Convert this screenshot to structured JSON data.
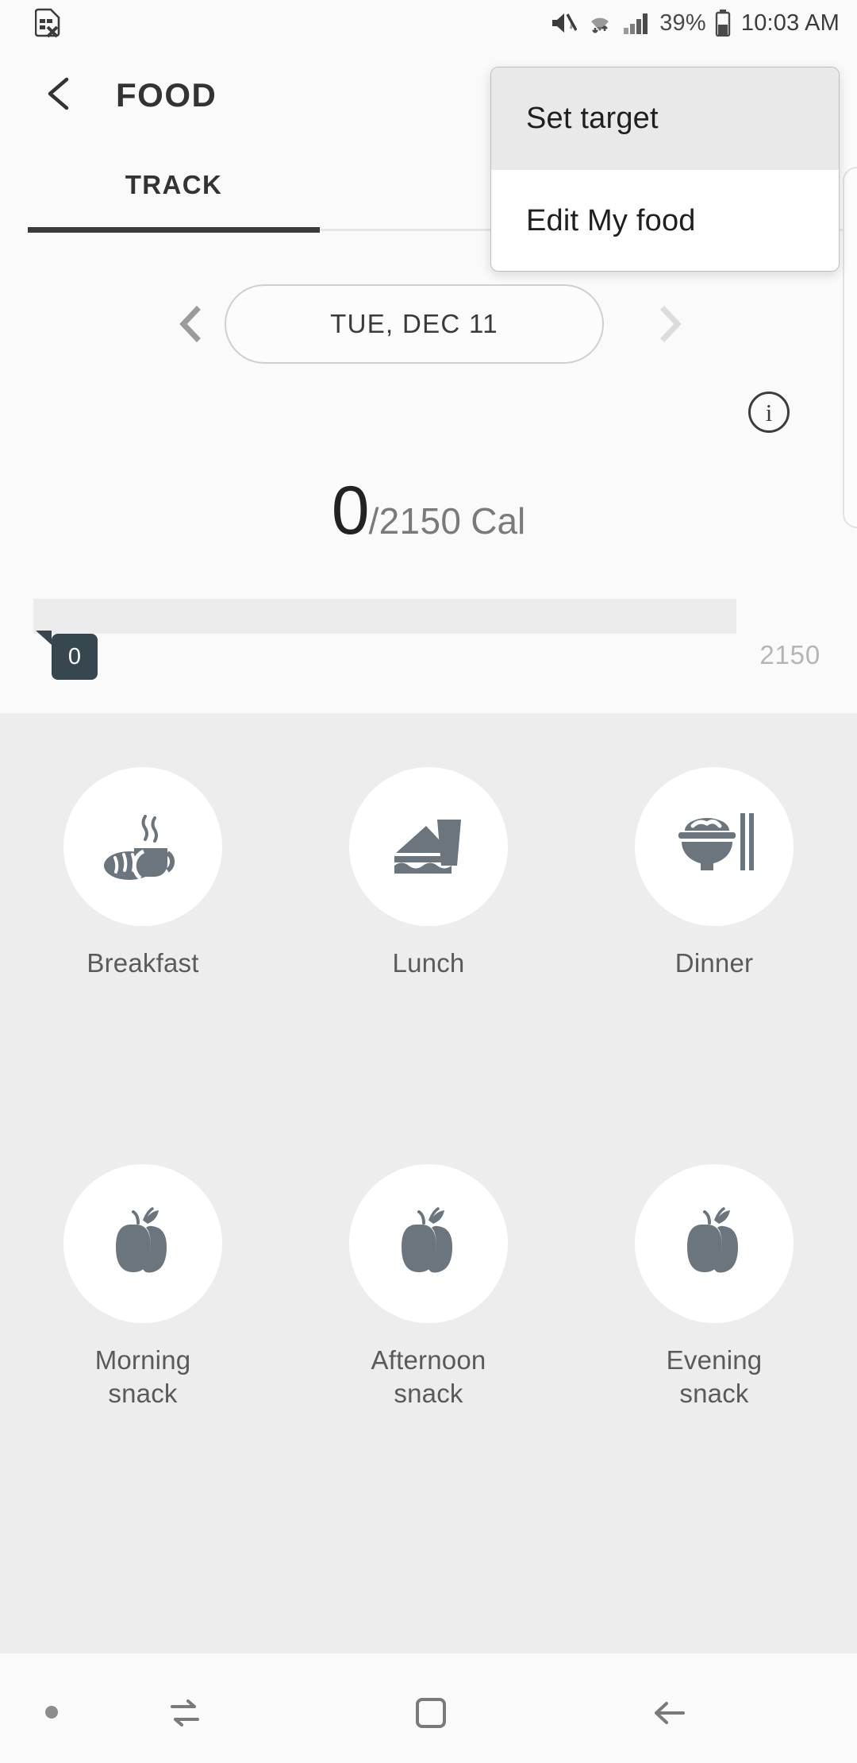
{
  "status_bar": {
    "left_icon": "sim-card-error-icon",
    "mute_icon": "mute-icon",
    "wifi_icon": "wifi-icon",
    "signal_icon": "cellular-signal-icon",
    "battery_percent": "39%",
    "battery_icon": "battery-icon",
    "time": "10:03 AM"
  },
  "app_bar": {
    "back_icon": "chevron-left-icon",
    "title": "FOOD"
  },
  "tabs": {
    "items": [
      {
        "label": "TRACK",
        "active": true
      }
    ]
  },
  "menu": {
    "items": [
      {
        "label": "Set target",
        "highlighted": true
      },
      {
        "label": "Edit My food",
        "highlighted": false
      }
    ]
  },
  "date_nav": {
    "prev_icon": "chevron-left-icon",
    "next_icon": "chevron-right-icon",
    "date": "TUE, DEC 11"
  },
  "info": {
    "icon": "info-circle-icon",
    "glyph": "i"
  },
  "calories": {
    "current": "0",
    "separator_target": "/2150",
    "unit": "Cal",
    "progress_badge": "0",
    "progress_max": "2150",
    "progress_percent": 0,
    "accent_dark": "#37474f",
    "track_color": "#ececec"
  },
  "meals": {
    "row1": [
      {
        "label": "Breakfast",
        "icon": "bread-and-coffee-icon"
      },
      {
        "label": "Lunch",
        "icon": "sandwich-and-drink-icon"
      },
      {
        "label": "Dinner",
        "icon": "rice-bowl-chopsticks-icon"
      }
    ],
    "row2": [
      {
        "label": "Morning\nsnack",
        "line1": "Morning",
        "line2": "snack",
        "icon": "fruit-icon"
      },
      {
        "label": "Afternoon\nsnack",
        "line1": "Afternoon",
        "line2": "snack",
        "icon": "fruit-icon"
      },
      {
        "label": "Evening\nsnack",
        "line1": "Evening",
        "line2": "snack",
        "icon": "fruit-icon"
      }
    ]
  },
  "nav_bar": {
    "recents_icon": "recents-icon",
    "home_icon": "home-square-icon",
    "back_icon": "back-arrow-icon"
  },
  "colors": {
    "page_bg": "#fafafa",
    "meals_bg": "#ededed",
    "icon_gray": "#6b757d",
    "text_dark": "#333333",
    "text_gray": "#7a7a7a"
  }
}
